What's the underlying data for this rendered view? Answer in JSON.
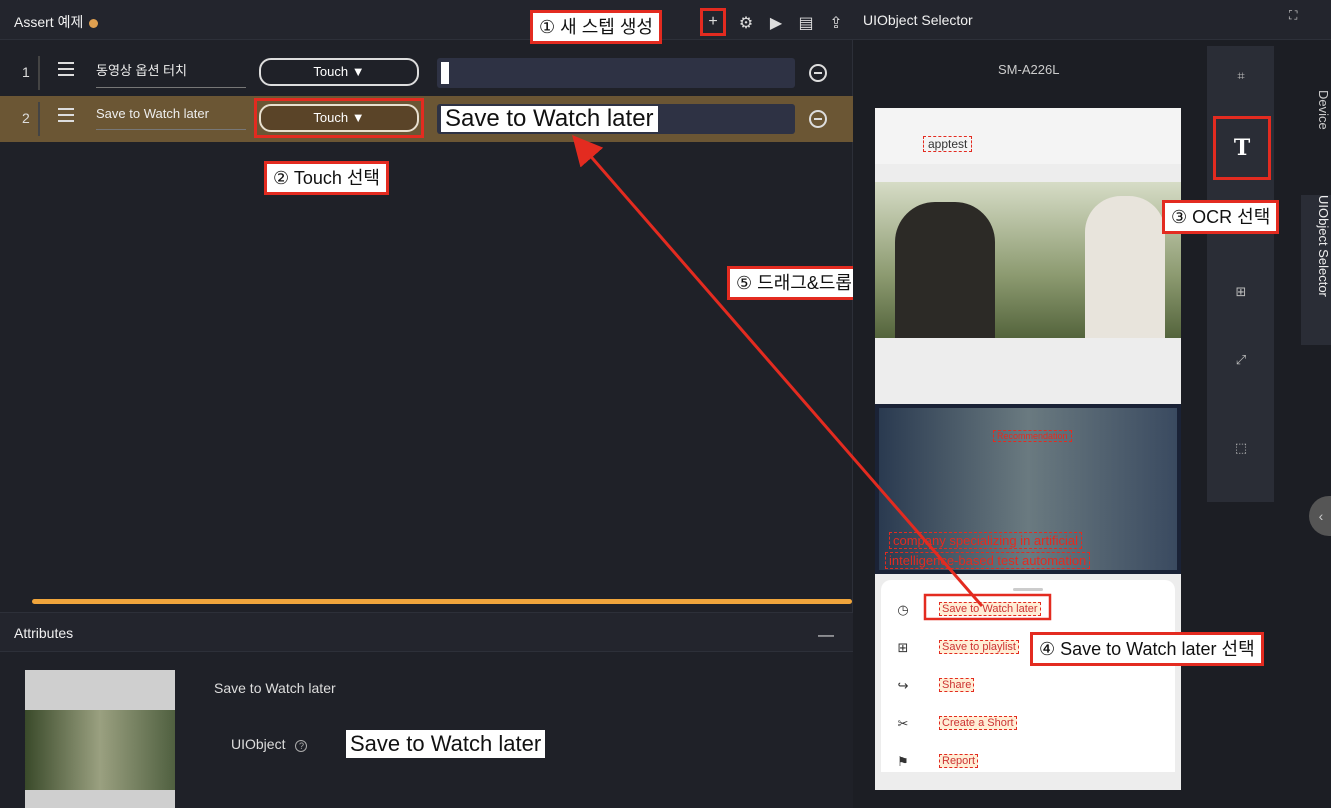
{
  "project": {
    "title": "Assert 예제"
  },
  "toolbar": {
    "add_icon": "plus-icon",
    "settings_icon": "gear-icon",
    "play_icon": "play-icon",
    "save_icon": "save-icon",
    "export_icon": "upload-icon"
  },
  "annotations": {
    "step1": "① 새 스텝 생성",
    "step2": "② Touch 선택",
    "step3": "③ OCR 선택",
    "step4": "④ Save to Watch later 선택",
    "step5": "⑤ 드래그&드롭",
    "accent": "#e32b20"
  },
  "steps": [
    {
      "num": "1",
      "label": "동영상 옵션 터치",
      "action": "Touch ▼",
      "value": ""
    },
    {
      "num": "2",
      "label": "Save to Watch later",
      "action": "Touch ▼",
      "value": "Save to Watch later"
    }
  ],
  "attributes": {
    "title": "Attributes",
    "collapse": "—",
    "name": "Save to Watch later",
    "uiobject_label": "UIObject",
    "uiobject_value": "Save to Watch later"
  },
  "selector": {
    "title": "UIObject Selector",
    "device": "SM-A226L",
    "tabs": [
      "Device",
      "UIObject Selector"
    ],
    "phone": {
      "search": "apptest",
      "sheet_items": [
        {
          "icon": "clock-icon",
          "label": "Save to Watch later"
        },
        {
          "icon": "playlist-add-icon",
          "label": "Save to playlist"
        },
        {
          "icon": "share-icon",
          "label": "Share"
        },
        {
          "icon": "shorts-icon",
          "label": "Create a Short"
        },
        {
          "icon": "flag-icon",
          "label": "Report"
        }
      ],
      "video_text_1": "company specializing in artificial",
      "video_text_2": "intelligence-based test automation",
      "video_badge": "Recommendation"
    }
  }
}
